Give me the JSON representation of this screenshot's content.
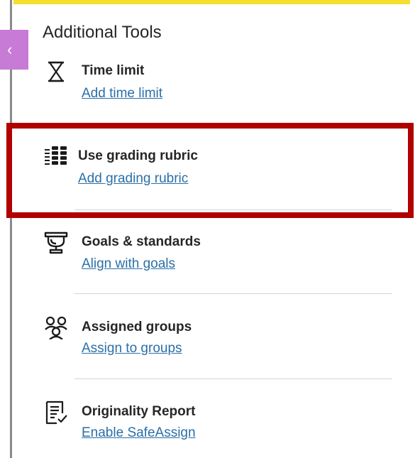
{
  "panel": {
    "title": "Additional Tools",
    "collapse_glyph": "‹"
  },
  "tools": [
    {
      "icon": "hourglass-icon",
      "title": "Time limit",
      "link": "Add time limit"
    },
    {
      "icon": "rubric-icon",
      "title": "Use grading rubric",
      "link": "Add grading rubric"
    },
    {
      "icon": "trophy-icon",
      "title": "Goals & standards",
      "link": "Align with goals"
    },
    {
      "icon": "group-icon",
      "title": "Assigned groups",
      "link": "Assign to groups"
    },
    {
      "icon": "report-icon",
      "title": "Originality Report",
      "link": "Enable SafeAssign"
    }
  ],
  "colors": {
    "accent_yellow": "#f5df2e",
    "collapse_tab": "#c77ad6",
    "link": "#2a6fa8",
    "highlight": "#b00000"
  }
}
